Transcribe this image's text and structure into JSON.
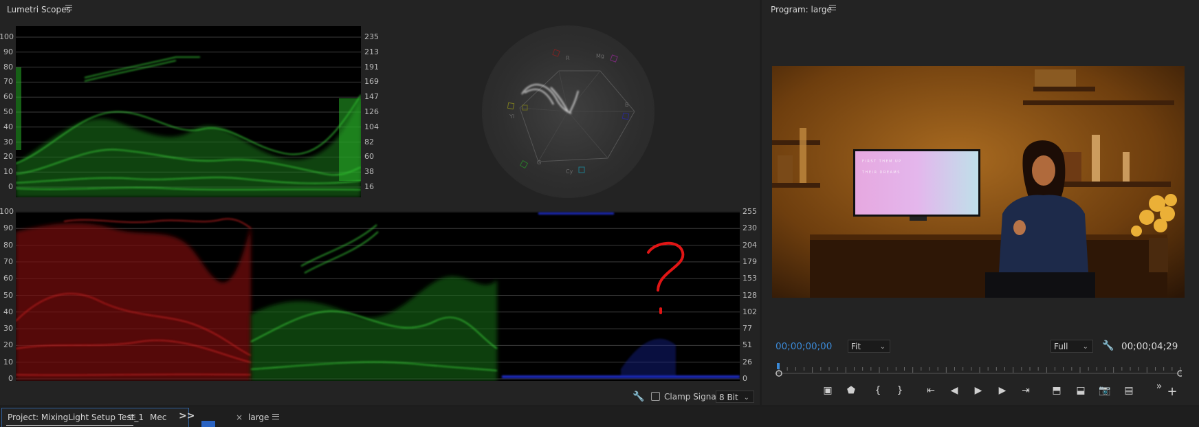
{
  "scopes_panel": {
    "title": "Lumetri Scopes",
    "ire_labels": [
      "100",
      "90",
      "80",
      "70",
      "60",
      "50",
      "40",
      "30",
      "20",
      "10",
      "0"
    ],
    "small_right_labels": [
      "235",
      "213",
      "191",
      "169",
      "147",
      "126",
      "104",
      "82",
      "60",
      "38",
      "16"
    ],
    "parade_right_labels": [
      "255",
      "230",
      "204",
      "179",
      "153",
      "128",
      "102",
      "77",
      "51",
      "26",
      "0"
    ],
    "vector_labels": {
      "r": "R",
      "mg": "Mg",
      "b": "B",
      "cy": "Cy",
      "g": "G",
      "yl": "Yl"
    },
    "clamp_signal": "Clamp Signal",
    "bit_depth": "8 Bit",
    "annotation": "?"
  },
  "program_panel": {
    "title": "Program: large",
    "timecode_current": "00;00;00;00",
    "zoom": "Fit",
    "resolution": "Full",
    "timecode_duration": "00;00;04;29",
    "tv_text_line1": "FIRST THEM UP",
    "tv_text_line2": "THEIR DREAMS"
  },
  "bottom_bar": {
    "project_tab": "Project: MixingLight Setup Test_1",
    "media_tab": "Mec",
    "more_icon": ">>",
    "close_icon": "×",
    "sequence_tab": "large"
  },
  "colors": {
    "accent_blue": "#3b8ad8",
    "waveform_green": "#2fbf2f",
    "parade_red": "#c41e1e",
    "parade_blue": "#1f2fd6",
    "annotation_red": "#e01515"
  }
}
